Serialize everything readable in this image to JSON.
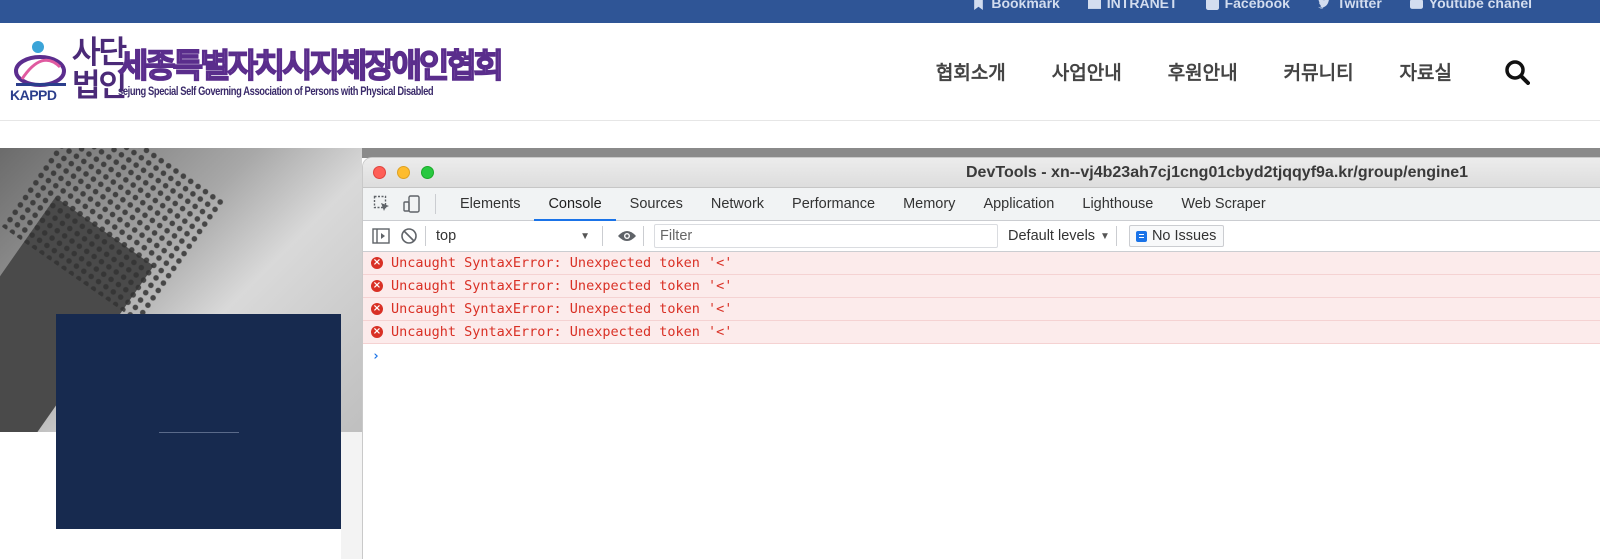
{
  "topbar": {
    "links": [
      {
        "label": "Bookmark",
        "icon": "bookmark-icon"
      },
      {
        "label": "INTRANET",
        "icon": "folder-icon"
      },
      {
        "label": "Facebook",
        "icon": "facebook-icon"
      },
      {
        "label": "Twitter",
        "icon": "twitter-icon"
      },
      {
        "label": "Youtube chanel",
        "icon": "youtube-icon"
      }
    ]
  },
  "header": {
    "logo": {
      "kappd": "KAPPD",
      "corp_line1": "사단",
      "corp_line2": "법인",
      "title_ko": "세종특별자치시지체장애인협회",
      "title_en": "sejung Special Self Governing Association of Persons with Physical Disabled"
    },
    "nav": [
      "협회소개",
      "사업안내",
      "후원안내",
      "커뮤니티",
      "자료실"
    ]
  },
  "devtools": {
    "window_title": "DevTools - xn--vj4b23ah7cj1cng01cbyd2tjqqyf9a.kr/group/engine1",
    "tabs": [
      {
        "label": "Elements",
        "active": false
      },
      {
        "label": "Console",
        "active": true
      },
      {
        "label": "Sources",
        "active": false
      },
      {
        "label": "Network",
        "active": false
      },
      {
        "label": "Performance",
        "active": false
      },
      {
        "label": "Memory",
        "active": false
      },
      {
        "label": "Application",
        "active": false
      },
      {
        "label": "Lighthouse",
        "active": false
      },
      {
        "label": "Web Scraper",
        "active": false
      }
    ],
    "console_toolbar": {
      "context": "top",
      "filter_placeholder": "Filter",
      "levels": "Default levels",
      "issues": "No Issues"
    },
    "messages": [
      {
        "type": "error",
        "text": "Uncaught SyntaxError: Unexpected token '<'"
      },
      {
        "type": "error",
        "text": "Uncaught SyntaxError: Unexpected token '<'"
      },
      {
        "type": "error",
        "text": "Uncaught SyntaxError: Unexpected token '<'"
      },
      {
        "type": "error",
        "text": "Uncaught SyntaxError: Unexpected token '<'"
      }
    ]
  },
  "colors": {
    "topbar": "#2f5596",
    "dark_box": "#172a4f",
    "error_text": "#d93025",
    "active_tab": "#1a73e8"
  }
}
